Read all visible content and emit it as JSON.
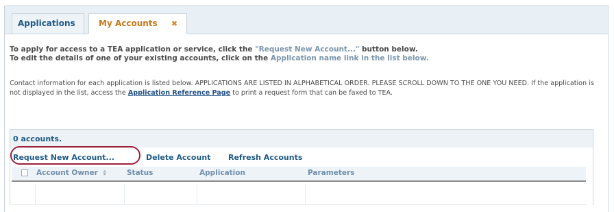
{
  "tabs": [
    {
      "label": "Applications"
    },
    {
      "label": "My Accounts",
      "close_glyph": "✖"
    }
  ],
  "instructions": {
    "line1_pre": "To apply for access to a TEA application or service, click the ",
    "line1_highlight": "\"Request New Account...\"",
    "line1_post": " button below.",
    "line2_pre": "To edit the details of one of your existing accounts, click on the ",
    "line2_highlight": "Application name link in the list below."
  },
  "contact": {
    "text_pre": "Contact information for each application is listed below. APPLICATIONS ARE LISTED IN ALPHABETICAL ORDER. PLEASE SCROLL DOWN TO THE ONE YOU NEED. If the application is not displayed in the list, access the ",
    "link_label": "Application Reference Page",
    "text_post": " to print a request form that can be faxed to TEA."
  },
  "accounts": {
    "count_label": "0 accounts.",
    "toolbar": {
      "request_label": "Request New Account...",
      "delete_label": "Delete Account",
      "refresh_label": "Refresh Accounts"
    },
    "columns": [
      "Account Owner",
      "Status",
      "Application",
      "Parameters"
    ],
    "sort_glyph": "⇕",
    "rows": []
  },
  "colors": {
    "link_blue": "#1f5a86",
    "tab_active_orange": "#c77a1a",
    "highlight_oval": "#9e1f3c"
  }
}
